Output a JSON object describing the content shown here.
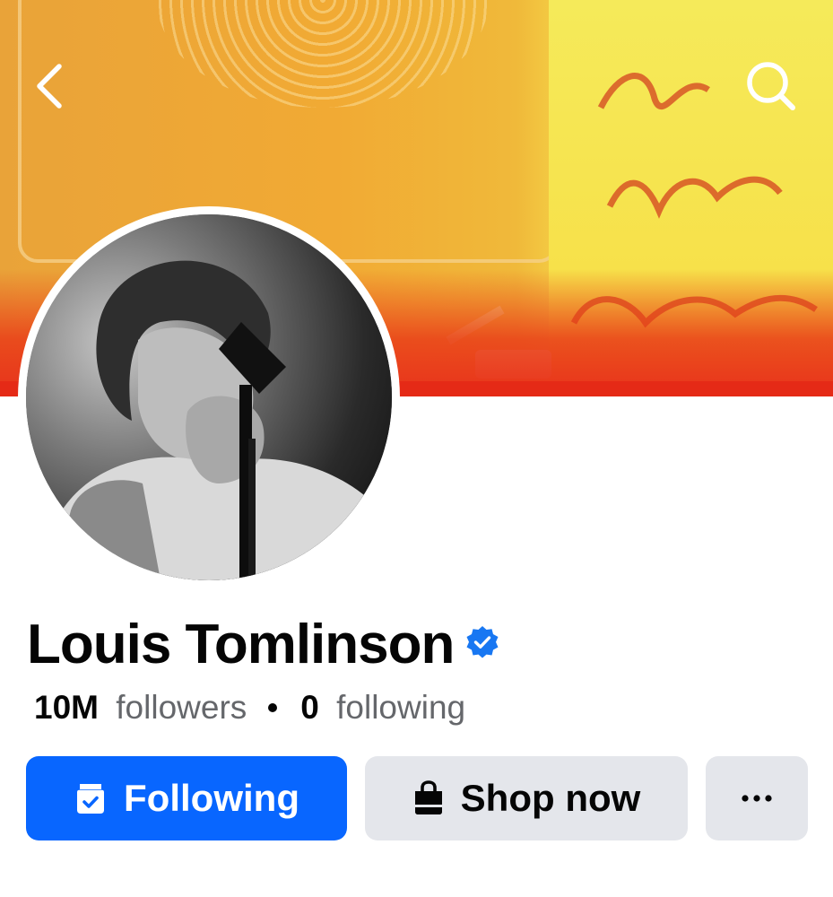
{
  "header": {
    "back_icon": "chevron-left-icon",
    "search_icon": "search-icon"
  },
  "profile": {
    "name": "Louis Tomlinson",
    "verified": true,
    "verified_color": "#1877f2",
    "followers_count": "10M",
    "followers_label": "followers",
    "following_count": "0",
    "following_label": "following"
  },
  "actions": {
    "following_label": "Following",
    "following_icon": "page-follow-check-icon",
    "shop_label": "Shop now",
    "shop_icon": "shopping-bag-icon",
    "more_icon": "more-dots-icon"
  },
  "colors": {
    "primary": "#0866ff",
    "secondary_button": "#e4e6eb",
    "text": "#050505",
    "muted_text": "#65676b"
  }
}
